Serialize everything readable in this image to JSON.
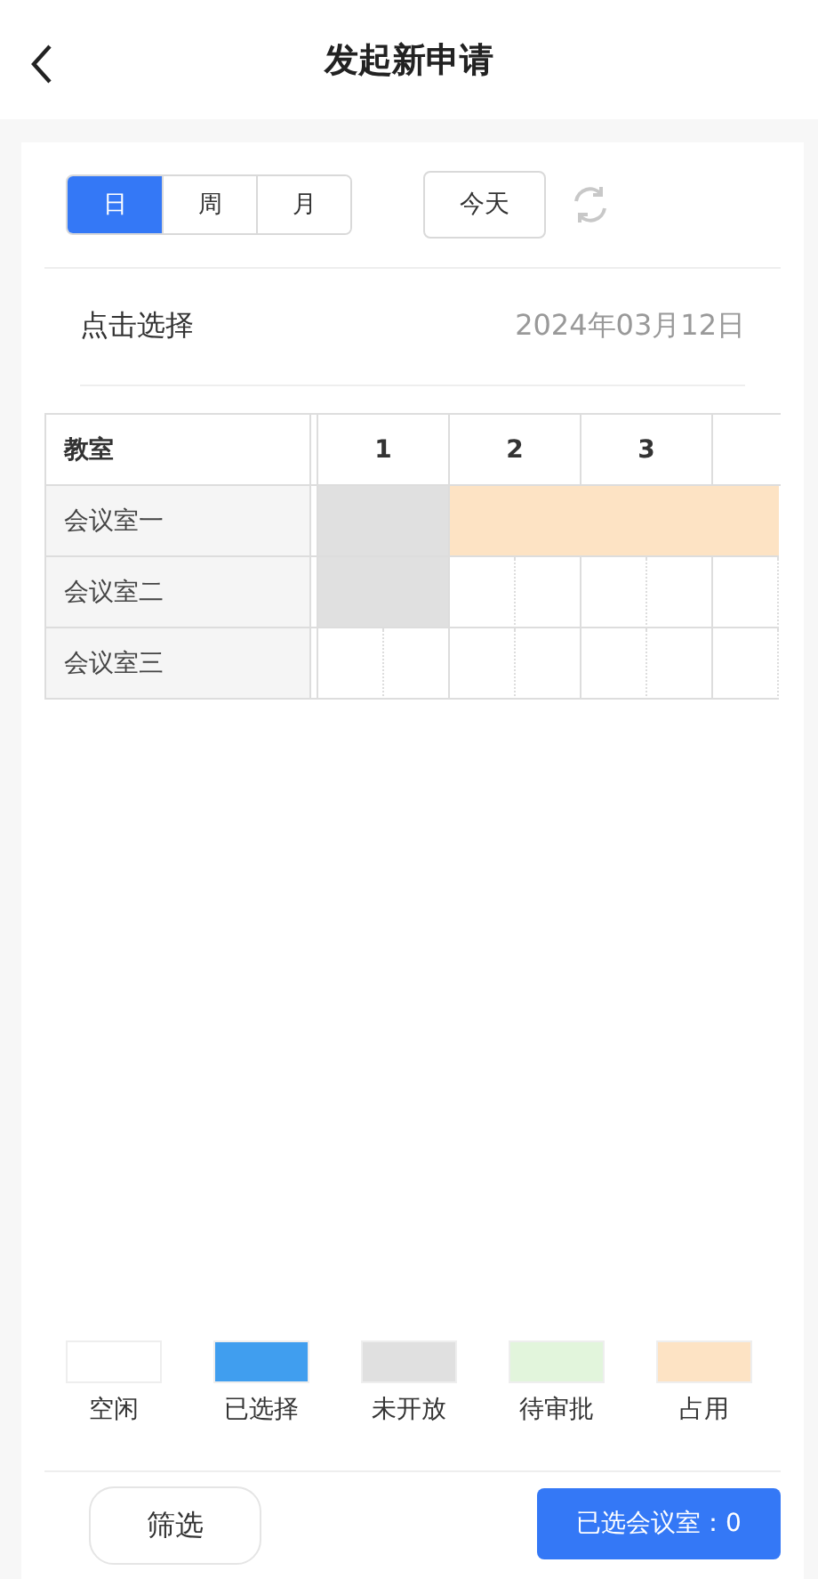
{
  "header": {
    "title": "发起新申请"
  },
  "view_tabs": [
    {
      "label": "日",
      "selected": true
    },
    {
      "label": "周",
      "selected": false
    },
    {
      "label": "月",
      "selected": false
    }
  ],
  "today_button": "今天",
  "date_row": {
    "label": "点击选择",
    "value": "2024年03月12日"
  },
  "grid": {
    "name_heading": "教室",
    "hours": [
      "1",
      "2",
      "3"
    ],
    "rooms": [
      {
        "name": "会议室一",
        "slots": [
          {
            "kind": "closed"
          },
          {
            "kind": "closed"
          },
          {
            "kind": "occupied"
          },
          {
            "kind": "occupied"
          },
          {
            "kind": "occupied"
          },
          {
            "kind": "occupied"
          },
          {
            "kind": "occupied"
          }
        ]
      },
      {
        "name": "会议室二",
        "slots": [
          {
            "kind": "closed"
          },
          {
            "kind": "closed"
          },
          {
            "kind": "free"
          },
          {
            "kind": "free"
          },
          {
            "kind": "free"
          },
          {
            "kind": "free"
          },
          {
            "kind": "free"
          }
        ]
      },
      {
        "name": "会议室三",
        "slots": [
          {
            "kind": "free"
          },
          {
            "kind": "free"
          },
          {
            "kind": "free"
          },
          {
            "kind": "free"
          },
          {
            "kind": "free"
          },
          {
            "kind": "free"
          },
          {
            "kind": "free"
          }
        ]
      }
    ]
  },
  "legend": [
    {
      "kind": "free",
      "label": "空闲",
      "color": "#ffffff"
    },
    {
      "kind": "selected",
      "label": "已选择",
      "color": "#409eef"
    },
    {
      "kind": "closed",
      "label": "未开放",
      "color": "#e0e0e0"
    },
    {
      "kind": "pending",
      "label": "待审批",
      "color": "#e2f5dc"
    },
    {
      "kind": "occupied",
      "label": "占用",
      "color": "#fde3c4"
    }
  ],
  "footer": {
    "filter_button": "筛选",
    "selected_button": "已选会议室：0"
  }
}
